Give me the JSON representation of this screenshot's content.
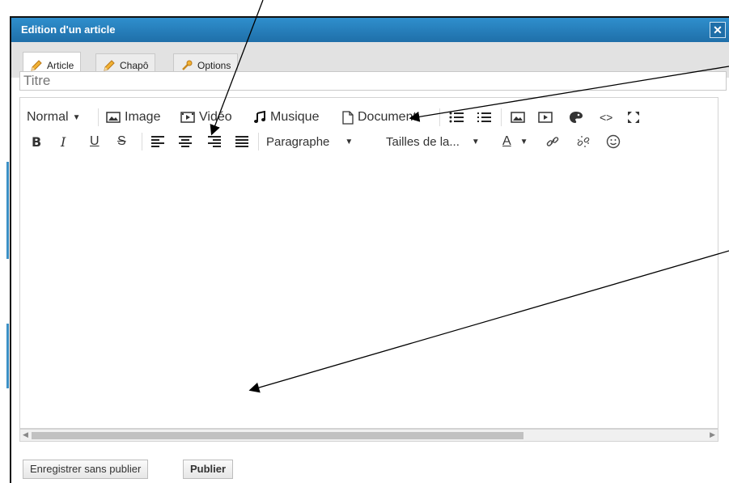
{
  "dialog": {
    "title": "Edition d'un article",
    "close_label": "✕"
  },
  "tabs": [
    {
      "label": "Article",
      "icon": "pencil-icon",
      "active": true
    },
    {
      "label": "Chapô",
      "icon": "pencil-icon",
      "active": false
    },
    {
      "label": "Options",
      "icon": "wrench-icon",
      "active": false
    }
  ],
  "title_field": {
    "placeholder": "Titre",
    "value": ""
  },
  "toolbar": {
    "row1": {
      "format_select": "Normal",
      "image": "Image",
      "video": "Vidéo",
      "music": "Musique",
      "document": "Document"
    },
    "row2": {
      "paragraph_select": "Paragraphe",
      "font_size_select": "Tailles de la..."
    }
  },
  "footer": {
    "save_draft": "Enregistrer sans publier",
    "publish": "Publier"
  },
  "colors": {
    "titlebar": "#2a84c2",
    "tab_bg": "#e2e2e2",
    "accent": "#3b8fc4"
  }
}
